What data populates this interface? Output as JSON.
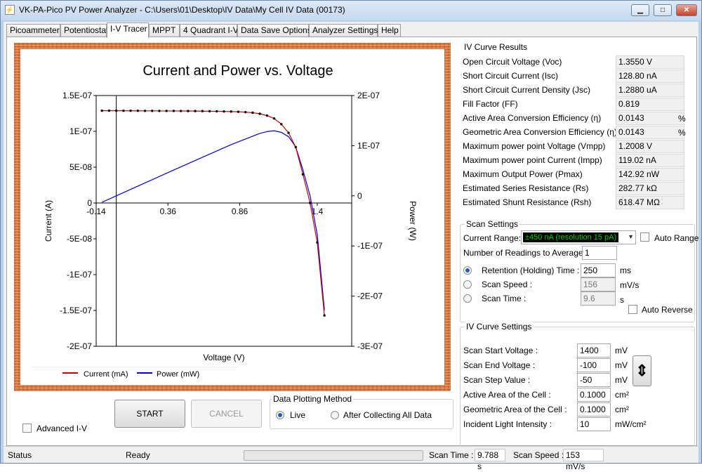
{
  "window": {
    "app_icon": "chart-app-icon",
    "title": "VK-PA-Pico PV Power Analyzer - C:\\Users\\01\\Desktop\\IV Data\\My Cell IV Data (00173)",
    "minimize": "▁",
    "maximize": "□",
    "close": "✕"
  },
  "tabs": [
    "Picoammeter",
    "Potentiostat",
    "I-V Tracer",
    "MPPT",
    "4 Quadrant I-V",
    "Data Save Options",
    "Analyzer Settings",
    "Help"
  ],
  "active_tab": "I-V Tracer",
  "chart_data": {
    "type": "line",
    "title": "Current and Power vs. Voltage",
    "xlabel": "Voltage (V)",
    "ylabel": "Current (A)",
    "y2label": "Power (W)",
    "xlim": [
      -0.14,
      1.64
    ],
    "ylim": [
      -2e-07,
      1.5e-07
    ],
    "y2lim": [
      -3e-07,
      2e-07
    ],
    "x_ticks": [
      "-0.14",
      "0.36",
      "0.86",
      "1.4"
    ],
    "y_ticks": [
      "1.5E-07",
      "1E-07",
      "5E-08",
      "0",
      "-5E-08",
      "-1E-07",
      "-1.5E-07",
      "-2E-07"
    ],
    "y2_ticks": [
      "2E-07",
      "1E-07",
      "0",
      "-1E-07",
      "-2E-07",
      "-3E-07"
    ],
    "legend_position": "bottom-left",
    "series": [
      {
        "name": "Current (mA)",
        "color": "#cc0000",
        "axis": "left",
        "x": [
          -0.1,
          -0.05,
          0.0,
          0.05,
          0.1,
          0.15,
          0.2,
          0.25,
          0.3,
          0.35,
          0.4,
          0.45,
          0.5,
          0.55,
          0.6,
          0.65,
          0.7,
          0.75,
          0.8,
          0.85,
          0.9,
          0.95,
          1.0,
          1.05,
          1.1,
          1.15,
          1.2,
          1.25,
          1.3,
          1.35,
          1.4,
          1.45
        ],
        "y": [
          1.288e-07,
          1.288e-07,
          1.288e-07,
          1.287e-07,
          1.287e-07,
          1.287e-07,
          1.286e-07,
          1.286e-07,
          1.285e-07,
          1.285e-07,
          1.285e-07,
          1.284e-07,
          1.284e-07,
          1.283e-07,
          1.282e-07,
          1.281e-07,
          1.28e-07,
          1.278e-07,
          1.276e-07,
          1.273e-07,
          1.268e-07,
          1.26e-07,
          1.245e-07,
          1.22e-07,
          1.18e-07,
          1.1e-07,
          9.8e-08,
          7.8e-08,
          4e-08,
          0.0,
          -5.5e-08,
          -1.57e-07
        ]
      },
      {
        "name": "Power (mW)",
        "color": "#0000dd",
        "axis": "right",
        "x": [
          -0.1,
          0.0,
          0.2,
          0.4,
          0.6,
          0.8,
          1.0,
          1.05,
          1.1,
          1.15,
          1.2,
          1.25,
          1.3,
          1.35,
          1.4,
          1.45
        ],
        "y": [
          -1.29e-08,
          0.0,
          2.57e-08,
          5.14e-08,
          7.69e-08,
          1.02e-07,
          1.245e-07,
          1.281e-07,
          1.298e-07,
          1.265e-07,
          1.18e-07,
          9.75e-08,
          5.2e-08,
          0.0,
          -7.7e-08,
          -2.28e-07
        ]
      }
    ]
  },
  "results": {
    "title": "IV Curve Results",
    "rows": [
      {
        "label": "Open Circuit Voltage (Voc)",
        "value": "1.3550 V",
        "unit": ""
      },
      {
        "label": "Short Circuit Current (Isc)",
        "value": "128.80 nA",
        "unit": ""
      },
      {
        "label": "Short Circuit Current Density (Jsc)",
        "value": "1.2880 uA",
        "unit": ""
      },
      {
        "label": "Fill Factor (FF)",
        "value": "0.819",
        "unit": ""
      },
      {
        "label": "Active Area Conversion Efficiency (η)",
        "value": "0.0143",
        "unit": "%"
      },
      {
        "label": "Geometric Area Conversion Efficiency (η)",
        "value": "0.0143",
        "unit": "%"
      },
      {
        "label": "Maximum power point Voltage (Vmpp)",
        "value": "1.2008 V",
        "unit": ""
      },
      {
        "label": "Maximum power point Current (Impp)",
        "value": "119.02 nA",
        "unit": ""
      },
      {
        "label": "Maximum Output Power (Pmax)",
        "value": "142.92 nW",
        "unit": ""
      },
      {
        "label": "Estimated Series Resistance (Rs)",
        "value": "282.77 kΩ",
        "unit": ""
      },
      {
        "label": "Estimated Shunt Resistance (Rsh)",
        "value": "618.47 MΩ",
        "unit": ""
      }
    ]
  },
  "scan": {
    "title": "Scan Settings",
    "current_range_label": "Current Range:",
    "current_range_value": "±450 nA (resolution 15 pA)",
    "auto_range": "Auto Range",
    "readings_label": "Number of Readings to Average :",
    "readings_value": "1",
    "retention_label": "Retention (Holding) Time :",
    "retention_value": "250",
    "retention_unit": "ms",
    "speed_label": "Scan Speed :",
    "speed_value": "156",
    "speed_unit": "mV/s",
    "time_label": "Scan Time :",
    "time_value": "9.6",
    "time_unit": "s",
    "auto_reverse": "Auto Reverse"
  },
  "iv": {
    "title": "IV Curve Settings",
    "rows": [
      {
        "label": "Scan Start Voltage :",
        "value": "1400",
        "unit": "mV"
      },
      {
        "label": "Scan End Voltage :",
        "value": "-100",
        "unit": "mV"
      },
      {
        "label": "Scan Step Value :",
        "value": "-50",
        "unit": "mV"
      },
      {
        "label": "Active Area of the Cell :",
        "value": "0.1000",
        "unit": "cm²"
      },
      {
        "label": "Geometric Area of the Cell :",
        "value": "0.1000",
        "unit": "cm²"
      },
      {
        "label": "Incident Light Intensity :",
        "value": "10",
        "unit": "mW/cm²"
      }
    ],
    "swap_icon": "up-down-arrow-icon"
  },
  "controls": {
    "advanced": "Advanced I-V",
    "start": "START",
    "cancel": "CANCEL",
    "plot_method_title": "Data Plotting Method",
    "live": "Live",
    "after": "After Collecting All Data"
  },
  "status": {
    "label": "Status",
    "state": "Ready",
    "scan_time_label": "Scan Time :",
    "scan_time_value": "9.788 s",
    "scan_speed_label": "Scan Speed :",
    "scan_speed_value": "153 mV/s"
  }
}
